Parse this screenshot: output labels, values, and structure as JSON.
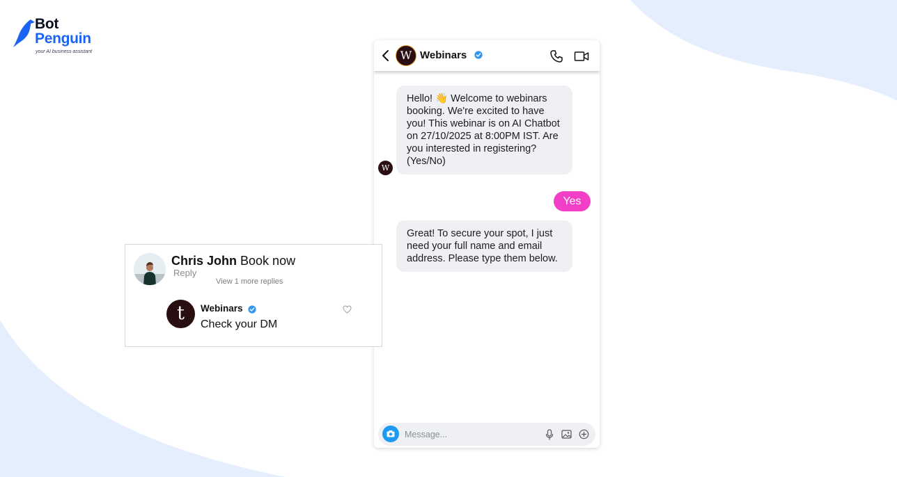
{
  "brand": {
    "name_line1": "Bot",
    "name_line2": "Penguin",
    "tagline": "your AI business assistant",
    "colors": {
      "dark": "#0a0f1e",
      "blue": "#1b63f5"
    }
  },
  "chat": {
    "header": {
      "avatar_letter": "W",
      "name": "Webinars",
      "verified": true,
      "icons": [
        "back-chevron-icon",
        "phone-icon",
        "video-icon"
      ]
    },
    "messages": [
      {
        "from": "bot",
        "text": "Hello! 👋 Welcome to webinars booking. We're excited to have you! This webinar is on AI Chatbot on 27/10/2025 at 8:00PM IST. Are you interested in registering? (Yes/No)"
      },
      {
        "from": "user",
        "text": "Yes"
      },
      {
        "from": "bot",
        "text": "Great! To secure your spot, I just need your full name and email address. Please type them below."
      }
    ],
    "bot_avatar_letter": "W",
    "composer": {
      "placeholder": "Message...",
      "icons": [
        "camera-icon",
        "microphone-icon",
        "image-icon",
        "add-circle-icon"
      ]
    },
    "colors": {
      "user_bubble": "#f23fc8",
      "bot_bubble": "#eef0f4",
      "verified": "#3797f0"
    }
  },
  "comment": {
    "author": "Chris John",
    "text": "Book now",
    "reply_label": "Reply",
    "more_replies_label": "View 1 more replies",
    "reply": {
      "avatar_letter": "t",
      "author": "Webinars",
      "verified": true,
      "text": "Check your DM"
    }
  }
}
